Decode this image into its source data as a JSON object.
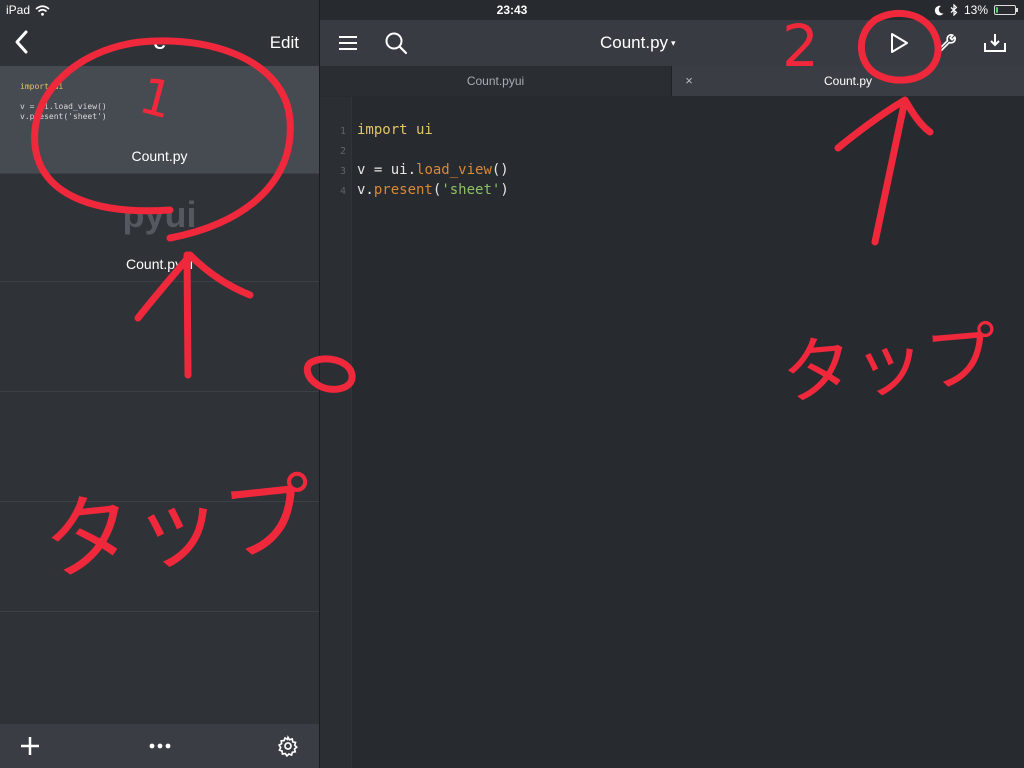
{
  "status_bar": {
    "device": "iPad",
    "time": "23:43",
    "battery": "13%",
    "battery_level": 0.13
  },
  "sidebar": {
    "title": "C",
    "edit_label": "Edit",
    "files": [
      {
        "name": "Count.py",
        "preview": [
          "import ui",
          "",
          "v = ui.load_view()",
          "v.present('sheet')"
        ]
      },
      {
        "name": "Count.pyui",
        "icon_text": "pyui"
      }
    ]
  },
  "editor": {
    "title": "Count.py",
    "tabs": [
      {
        "label": "Count.pyui"
      },
      {
        "label": "Count.py"
      }
    ],
    "tab_close_glyph": "×",
    "line_numbers": [
      "1",
      "2",
      "3",
      "4"
    ],
    "code": {
      "l1_kw": "import",
      "l1_mod": " ui",
      "l3_a": "v = ui.",
      "l3_fn": "load_view",
      "l3_b": "()",
      "l4_a": "v.",
      "l4_fn": "present",
      "l4_b": "(",
      "l4_st": "'sheet'",
      "l4_c": ")"
    }
  },
  "annotations": {
    "step1": "1",
    "step2": "2",
    "note_left": "タップ",
    "note_right": "タップ"
  }
}
